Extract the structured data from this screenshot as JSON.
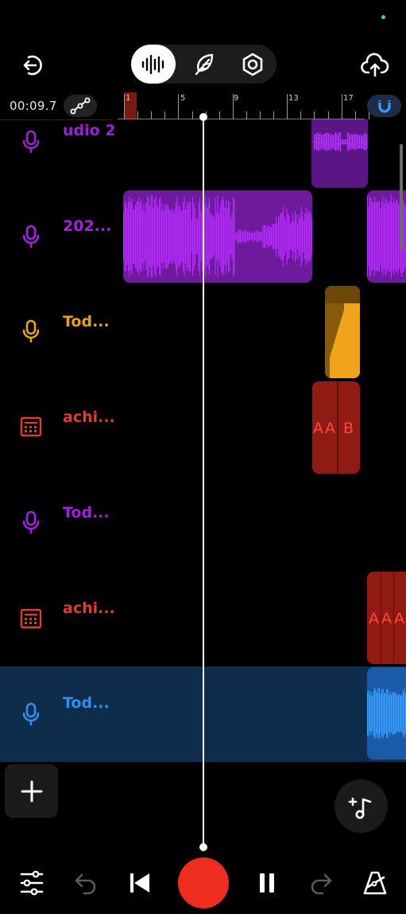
{
  "status": {
    "indicator_color": "#3fd39a"
  },
  "header": {
    "back_icon": "exit-arrow-icon",
    "upload_icon": "cloud-upload-icon",
    "modes": [
      {
        "name": "waveform-mode",
        "icon": "waveform-icon",
        "active": true
      },
      {
        "name": "effects-mode",
        "icon": "feather-icon",
        "active": false
      },
      {
        "name": "settings-mode",
        "icon": "hexagon-gear-icon",
        "active": false
      }
    ]
  },
  "timeline": {
    "time_readout": "00:09.7",
    "ruler_labels": [
      "1",
      "5",
      "9",
      "13",
      "17"
    ],
    "snap_icon": "magnet-icon",
    "automation_icon": "node-curve-icon"
  },
  "tracks": [
    {
      "name": "udio 2",
      "type": "audio",
      "color": "#9d1fd6",
      "icon": "microphone-icon",
      "selected": false
    },
    {
      "name": "202...",
      "type": "audio",
      "color": "#a81fe0",
      "icon": "microphone-icon",
      "selected": false
    },
    {
      "name": "Tod...",
      "type": "audio",
      "color": "#e8a01e",
      "icon": "microphone-icon",
      "selected": false
    },
    {
      "name": "achi...",
      "type": "drum-machine",
      "color": "#e33b2e",
      "icon": "drum-machine-icon",
      "selected": false
    },
    {
      "name": "Tod...",
      "type": "audio",
      "color": "#a020e0",
      "icon": "microphone-icon",
      "selected": false
    },
    {
      "name": "achi...",
      "type": "drum-machine",
      "color": "#e33b2e",
      "icon": "drum-machine-icon",
      "selected": false
    },
    {
      "name": "Tod...",
      "type": "audio",
      "color": "#2f8ff0",
      "icon": "microphone-icon",
      "selected": true
    }
  ],
  "clips": {
    "drum_clip_1_labels": [
      "A",
      "A",
      "B"
    ],
    "drum_clip_2_labels": [
      "A",
      "A",
      "A"
    ]
  },
  "footer": {
    "mixer_icon": "sliders-icon",
    "undo_icon": "undo-icon",
    "rewind_icon": "skip-to-start-icon",
    "record_color": "#ee2d1e",
    "pause_icon": "pause-icon",
    "redo_icon": "redo-icon",
    "metronome_icon": "metronome-icon",
    "add_track_icon": "plus-icon",
    "add_instrument_icon": "add-music-note-icon"
  }
}
